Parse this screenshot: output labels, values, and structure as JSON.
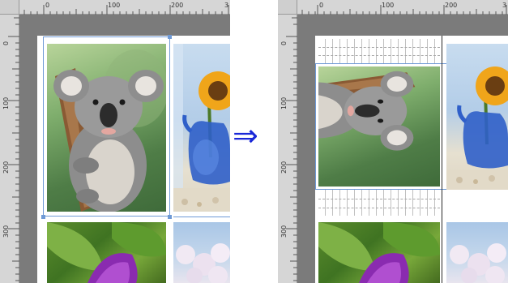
{
  "ruler": {
    "top_labels": [
      "0",
      "100",
      "200",
      "3"
    ],
    "left_labels": [
      "0",
      "100",
      "200",
      "300"
    ]
  },
  "arrow": {
    "glyph": "⇒"
  },
  "panels": {
    "before": {
      "photos": [
        "koala-photo",
        "sunflower-photo",
        "leaf-flower-photo",
        "cherry-blossom-photo"
      ]
    },
    "after": {
      "photos": [
        "koala-photo-rotated",
        "sunflower-photo",
        "leaf-flower-photo",
        "cherry-blossom-photo"
      ]
    }
  },
  "colors": {
    "selection": "#6f9ad6",
    "arrow": "#1a28d8",
    "workspace": "#7b7b7b",
    "ruler": "#d6d6d6"
  }
}
